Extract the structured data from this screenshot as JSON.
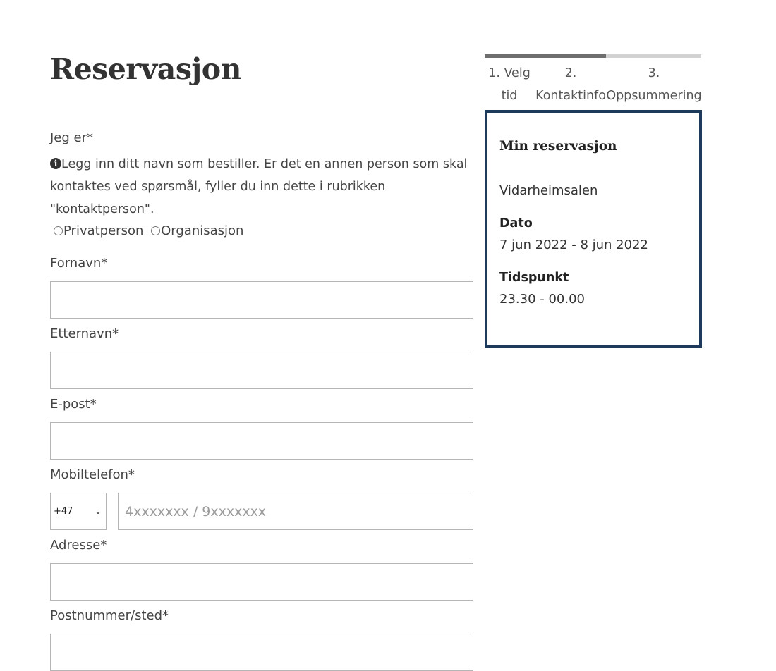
{
  "page": {
    "title": "Reservasjon"
  },
  "form": {
    "customer_type_label": "Jeg er*",
    "info_icon": "info-circle-icon",
    "info_text": "Legg inn ditt navn som bestiller. Er det en annen person som skal kontaktes ved spørsmål, fyller du inn dette i rubrikken \"kontaktperson\".",
    "radio_private": "Privatperson",
    "radio_org": "Organisasjon",
    "firstname_label": "Fornavn*",
    "firstname_value": "",
    "lastname_label": "Etternavn*",
    "lastname_value": "",
    "email_label": "E-post*",
    "email_value": "",
    "phone_label": "Mobiltelefon*",
    "phone_country_code": "+47",
    "phone_placeholder": "4xxxxxxx / 9xxxxxxx",
    "address_label": "Adresse*",
    "address_value": "",
    "postal_label": "Postnummer/sted*",
    "postal_value": ""
  },
  "steps": {
    "progress_fraction": 0.56,
    "step1_a": "1. Velg",
    "step1_b": "tid",
    "step2_a": "2.",
    "step2_b": "Kontaktinfo",
    "step3_a": "3.",
    "step3_b": "Oppsummering"
  },
  "summary": {
    "title": "Min reservasjon",
    "venue": "Vidarheimsalen",
    "date_label": "Dato",
    "date_value": "7 jun 2022 - 8 jun 2022",
    "time_label": "Tidspunkt",
    "time_value": "23.30 - 00.00",
    "border_color": "#1e3a5a"
  }
}
